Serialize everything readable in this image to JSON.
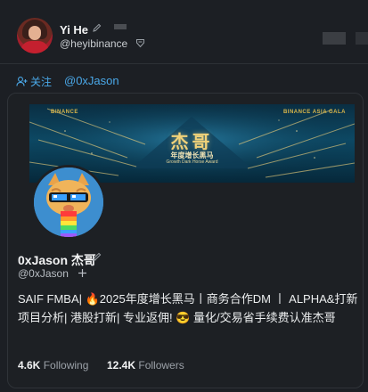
{
  "header": {
    "display_name": "Yi He",
    "handle": "@heyibinance"
  },
  "follow_row": {
    "follow_label": "关注",
    "target_handle": "@0xJason"
  },
  "banner": {
    "logo_left": "BINANCE",
    "logo_right": "BINANCE ASIA GALA",
    "title": "杰哥",
    "subtitle_cn": "年度增长黑马",
    "subtitle_en": "Growth Dark Horse Award"
  },
  "profile": {
    "name": "0xJason 杰哥",
    "handle": "@0xJason",
    "bio": "SAIF FMBA| 🔥2025年度增长黑马丨商务合作DM 丨 ALPHA&打新项目分析| 港股打新| 专业返佣! 😎 量化/交易省手续费认准杰哥"
  },
  "stats": {
    "following_count": "4.6K",
    "following_label": "Following",
    "followers_count": "12.4K",
    "followers_label": "Followers"
  },
  "colors": {
    "accent": "#4aa8e8",
    "background": "#1c1f24",
    "banner_gold": "#f0d27a"
  }
}
